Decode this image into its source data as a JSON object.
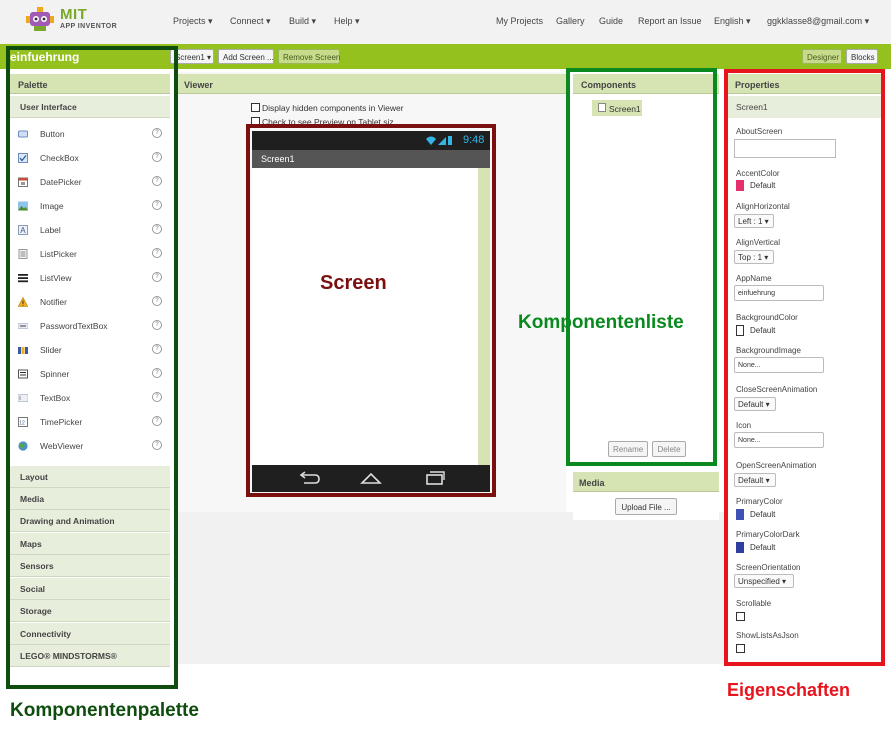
{
  "header": {
    "logo_title": "MIT",
    "logo_subtitle": "APP INVENTOR",
    "menus": [
      {
        "label": "Projects ▾"
      },
      {
        "label": "Connect ▾"
      },
      {
        "label": "Build ▾"
      },
      {
        "label": "Help ▾"
      }
    ],
    "right_links": [
      {
        "label": "My Projects"
      },
      {
        "label": "Gallery"
      },
      {
        "label": "Guide"
      },
      {
        "label": "Report an Issue"
      },
      {
        "label": "English ▾"
      },
      {
        "label": "ggkklasse8@gmail.com ▾"
      }
    ]
  },
  "toolbar": {
    "project_name": "einfuehrung",
    "screen_select": "Screen1 ▾",
    "add_screen": "Add Screen ...",
    "remove_screen": "Remove Screen",
    "designer": "Designer",
    "blocks": "Blocks"
  },
  "palette": {
    "title": "Palette",
    "open_category": "User Interface",
    "items": [
      {
        "label": "Button",
        "icon": "button-icon"
      },
      {
        "label": "CheckBox",
        "icon": "checkbox-icon"
      },
      {
        "label": "DatePicker",
        "icon": "calendar-icon"
      },
      {
        "label": "Image",
        "icon": "image-icon"
      },
      {
        "label": "Label",
        "icon": "label-icon"
      },
      {
        "label": "ListPicker",
        "icon": "list-icon"
      },
      {
        "label": "ListView",
        "icon": "listview-icon"
      },
      {
        "label": "Notifier",
        "icon": "warning-icon"
      },
      {
        "label": "PasswordTextBox",
        "icon": "password-icon"
      },
      {
        "label": "Slider",
        "icon": "slider-icon"
      },
      {
        "label": "Spinner",
        "icon": "spinner-icon"
      },
      {
        "label": "TextBox",
        "icon": "textbox-icon"
      },
      {
        "label": "TimePicker",
        "icon": "clock-icon"
      },
      {
        "label": "WebViewer",
        "icon": "globe-icon"
      }
    ],
    "categories": [
      {
        "label": "Layout"
      },
      {
        "label": "Media"
      },
      {
        "label": "Drawing and Animation"
      },
      {
        "label": "Maps"
      },
      {
        "label": "Sensors"
      },
      {
        "label": "Social"
      },
      {
        "label": "Storage"
      },
      {
        "label": "Connectivity"
      },
      {
        "label": "LEGO® MINDSTORMS®"
      }
    ]
  },
  "viewer": {
    "title": "Viewer",
    "hidden_components": "Display hidden components in Viewer",
    "tablet_preview": "Check to see Preview on Tablet size.",
    "status_time": "9:48",
    "screen_title": "Screen1"
  },
  "components": {
    "title": "Components",
    "tree_root": "Screen1",
    "rename": "Rename",
    "delete": "Delete"
  },
  "media": {
    "title": "Media",
    "upload": "Upload File ..."
  },
  "properties": {
    "title": "Properties",
    "component": "Screen1",
    "about_screen": "AboutScreen",
    "accent_color": "AccentColor",
    "accent_value": "Default",
    "align_horizontal": "AlignHorizontal",
    "align_horizontal_value": "Left : 1 ▾",
    "align_vertical": "AlignVertical",
    "align_vertical_value": "Top : 1 ▾",
    "app_name": "AppName",
    "app_name_value": "einfuehrung",
    "background_color": "BackgroundColor",
    "background_color_value": "Default",
    "background_image": "BackgroundImage",
    "background_image_value": "None...",
    "close_screen_animation": "CloseScreenAnimation",
    "close_screen_animation_value": "Default ▾",
    "icon": "Icon",
    "icon_value": "None...",
    "open_screen_animation": "OpenScreenAnimation",
    "open_screen_animation_value": "Default ▾",
    "primary_color": "PrimaryColor",
    "primary_color_value": "Default",
    "primary_color_dark": "PrimaryColorDark",
    "primary_color_dark_value": "Default",
    "screen_orientation": "ScreenOrientation",
    "screen_orientation_value": "Unspecified ▾",
    "scrollable": "Scrollable",
    "show_lists_as_json": "ShowListsAsJson"
  },
  "annotations": {
    "screen": "Screen",
    "komponentenliste": "Komponentenliste",
    "komponentenpalette": "Komponentenpalette",
    "eigenschaften": "Eigenschaften"
  },
  "colors": {
    "brand_green": "#95c11f",
    "accent_pink": "#e5306b",
    "primary_blue": "#3f51b5",
    "primary_dark": "#303f9f",
    "frame_red": "#e8141d",
    "frame_green": "#0a8a1e",
    "frame_darkgreen": "#0f4d0f",
    "frame_maroon": "#7a1010"
  }
}
